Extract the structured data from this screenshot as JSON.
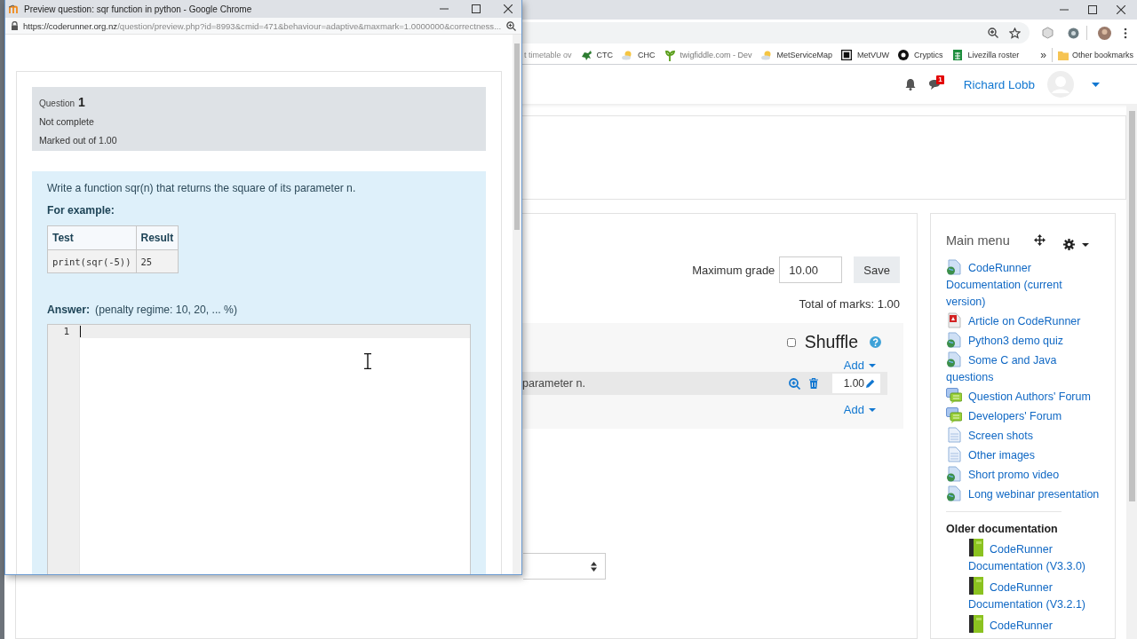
{
  "popup": {
    "title": "Preview question: sqr function in python - Google Chrome",
    "url_host": "https://coderunner.org.nz",
    "url_path": "/question/preview.php?id=8993&cmid=471&behaviour=adaptive&maxmark=1.0000000&correctness...",
    "question": {
      "label": "Question",
      "number": "1",
      "state": "Not complete",
      "mark": "Marked out of 1.00"
    },
    "prompt": "Write a function sqr(n) that returns the square of its parameter n.",
    "example_heading": "For example:",
    "example_table": {
      "columns": [
        "Test",
        "Result"
      ],
      "rows": [
        [
          "print(sqr(-5))",
          "25"
        ]
      ]
    },
    "answer_label": "Answer:",
    "penalty": "(penalty regime: 10, 20, ... %)",
    "editor": {
      "line_numbers": [
        "1"
      ]
    }
  },
  "bookmarks": [
    {
      "label": "t timetable ov",
      "kind": "none"
    },
    {
      "label": "CTC",
      "kind": "critter"
    },
    {
      "label": "CHC",
      "kind": "weather"
    },
    {
      "label": "twigfiddle.com - Dev",
      "kind": "sprout"
    },
    {
      "label": "MetServiceMap",
      "kind": "weather"
    },
    {
      "label": "MetVUW",
      "kind": "square"
    },
    {
      "label": "Cryptics",
      "kind": "circle"
    },
    {
      "label": "Livezilla roster",
      "kind": "sheet"
    }
  ],
  "more_bookmarks": "»",
  "other_bookmarks": "Other bookmarks",
  "navbar": {
    "message_count": "1",
    "user": "Richard Lobb"
  },
  "quiz": {
    "max_grade_label": "Maximum grade",
    "max_grade": "10.00",
    "save": "Save",
    "total": "Total of marks: 1.00",
    "shuffle": {
      "label": "Shuffle",
      "checked": false
    },
    "add_links": [
      "Add",
      "Add"
    ],
    "slot": {
      "text": "parameter n.",
      "mark": "1.00"
    }
  },
  "main_menu": {
    "title": "Main menu",
    "items": [
      {
        "label": "CodeRunner Documentation (current version)",
        "kind": "web"
      },
      {
        "label": "Article on CodeRunner",
        "kind": "pdf"
      },
      {
        "label": "Python3 demo quiz",
        "kind": "web"
      },
      {
        "label": "Some C and Java questions",
        "kind": "web"
      },
      {
        "label": "Question Authors' Forum",
        "kind": "forum"
      },
      {
        "label": "Developers' Forum",
        "kind": "forum"
      },
      {
        "label": "Screen shots",
        "kind": "page"
      },
      {
        "label": "Other images",
        "kind": "page"
      },
      {
        "label": "Short promo video",
        "kind": "web"
      },
      {
        "label": "Long webinar presentation",
        "kind": "web"
      }
    ]
  },
  "older_docs": {
    "title": "Older documentation",
    "items": [
      {
        "label": "CodeRunner Documentation (V3.3.0)",
        "kind": "book"
      },
      {
        "label": "CodeRunner Documentation (V3.2.1)",
        "kind": "book"
      },
      {
        "label": "CodeRunner",
        "kind": "book"
      }
    ]
  }
}
